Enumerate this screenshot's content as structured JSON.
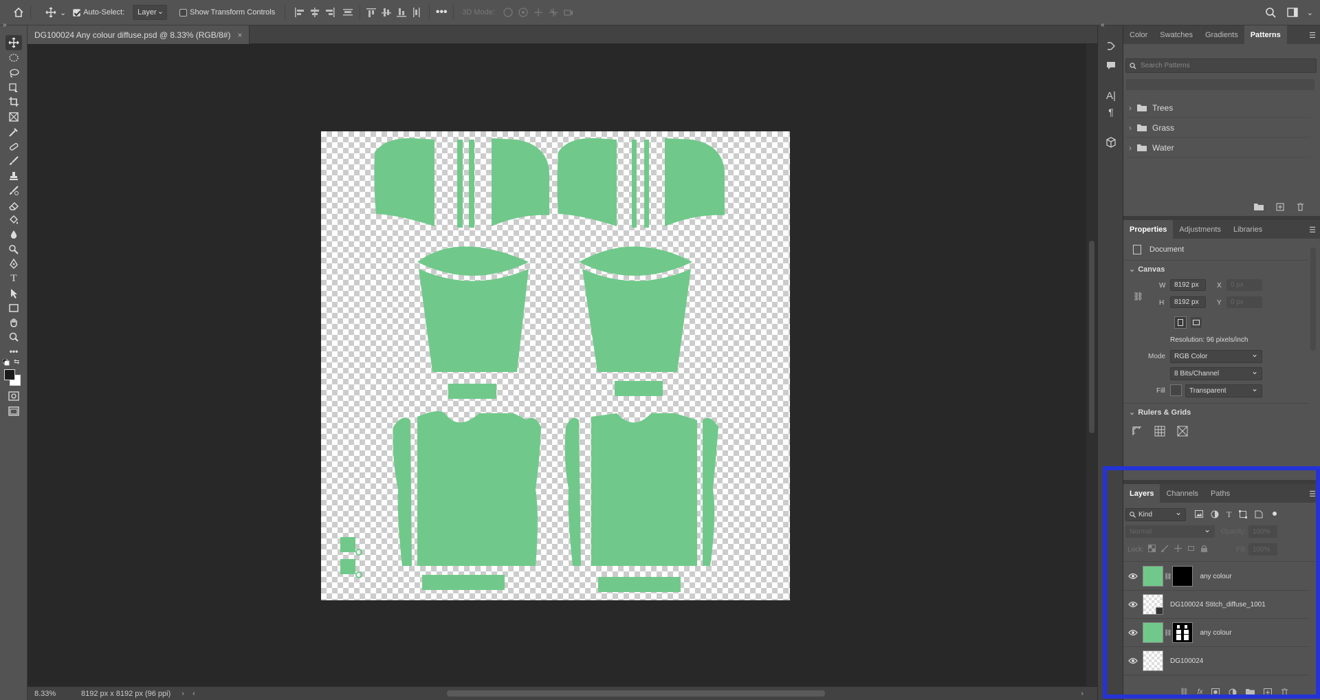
{
  "options_bar": {
    "auto_select_label": "Auto-Select:",
    "auto_select_checked": true,
    "auto_select_target": "Layer",
    "show_transform_label": "Show Transform Controls",
    "show_transform_checked": false,
    "three_d_mode_label": "3D Mode:"
  },
  "document": {
    "tab_title": "DG100024 Any colour diffuse.psd @ 8.33% (RGB/8#)",
    "close_glyph": "×",
    "fill_color": "#70c98a"
  },
  "status_bar": {
    "zoom": "8.33%",
    "doc_info": "8192 px x 8192 px (96 ppi)"
  },
  "patterns_panel": {
    "tabs": [
      "Color",
      "Swatches",
      "Gradients",
      "Patterns"
    ],
    "active_tab": "Patterns",
    "search_placeholder": "Search Patterns",
    "folders": [
      "Trees",
      "Grass",
      "Water"
    ]
  },
  "properties_panel": {
    "tabs": [
      "Properties",
      "Adjustments",
      "Libraries"
    ],
    "active_tab": "Properties",
    "doc_label": "Document",
    "canvas_section": "Canvas",
    "w_label": "W",
    "w_value": "8192 px",
    "h_label": "H",
    "h_value": "8192 px",
    "x_label": "X",
    "x_placeholder": "0 px",
    "y_label": "Y",
    "y_placeholder": "0 px",
    "resolution": "Resolution: 96 pixels/inch",
    "mode_label": "Mode",
    "mode_value": "RGB Color",
    "bits_value": "8 Bits/Channel",
    "fill_label": "Fill",
    "fill_value": "Transparent",
    "rulers_section": "Rulers & Grids"
  },
  "layers_panel": {
    "tabs": [
      "Layers",
      "Channels",
      "Paths"
    ],
    "active_tab": "Layers",
    "kind_label": "Kind",
    "blend_mode": "Normal",
    "opacity_label": "Opacity:",
    "opacity_value": "100%",
    "lock_label": "Lock:",
    "fill_label": "Fill:",
    "fill_value": "100%",
    "layers": [
      {
        "name": "any colour",
        "thumb": "green",
        "mask": "black"
      },
      {
        "name": "DG100024 Stitch_diffuse_1001",
        "thumb": "checker",
        "mask": null
      },
      {
        "name": "any colour",
        "thumb": "green",
        "mask": "pattern"
      },
      {
        "name": "DG100024",
        "thumb": "checker",
        "mask": null
      }
    ]
  },
  "colors": {
    "highlight_border": "#2433d6",
    "garment_green": "#70c98a"
  }
}
